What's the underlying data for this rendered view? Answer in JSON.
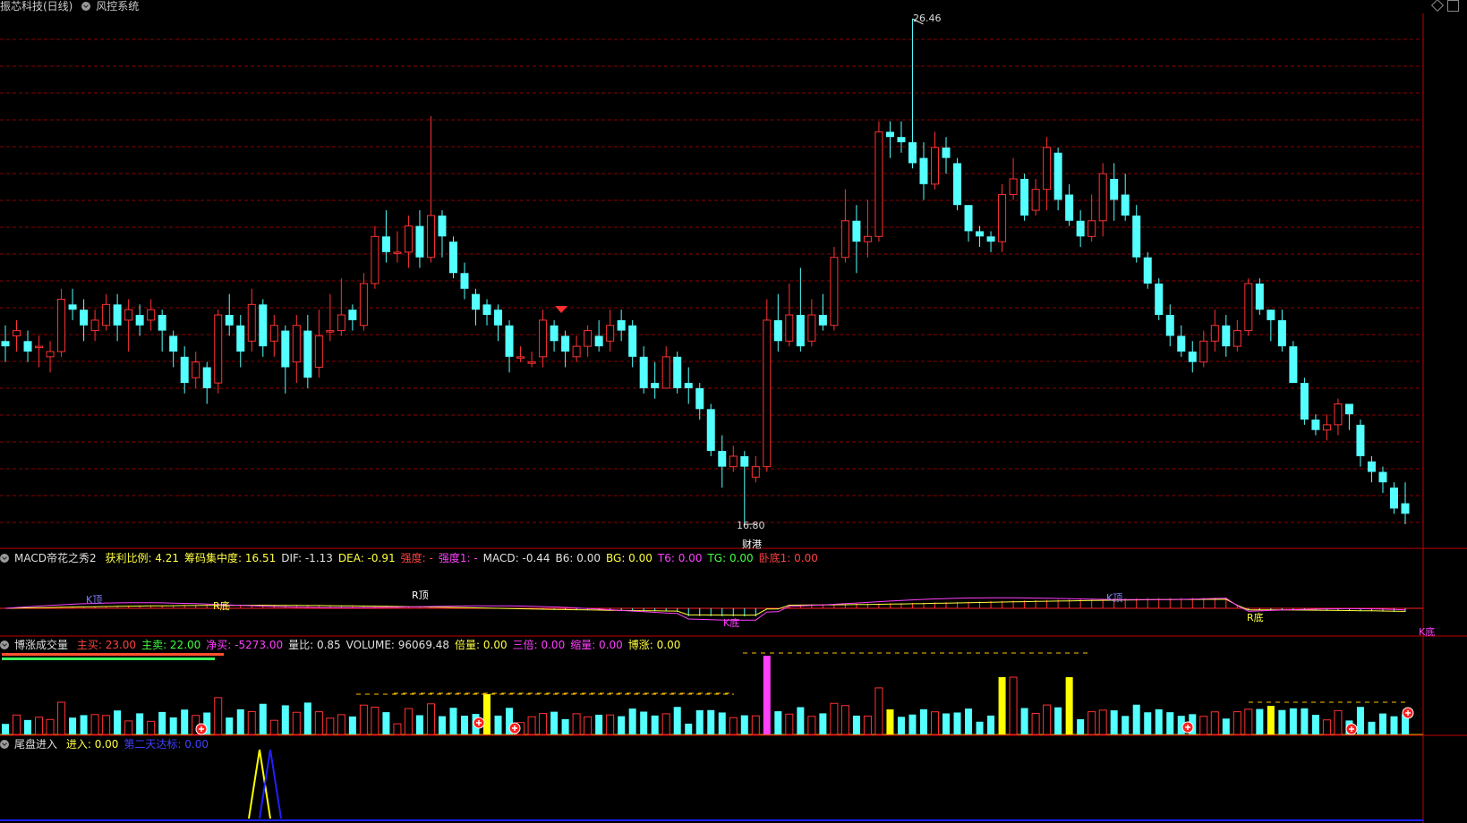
{
  "header": {
    "stock_name": "振芯科技(日线)",
    "system_name": "风控系统"
  },
  "price_panel": {
    "high_label": "26.46",
    "low_label": "16.80",
    "event_label": "财港"
  },
  "macd_panel": {
    "title": "MACD帝花之秀2",
    "items": [
      {
        "label": "获利比例: 4.21",
        "color": "#ffff40"
      },
      {
        "label": "筹码集中度: 16.51",
        "color": "#ffff40"
      },
      {
        "label": "DIF: -1.13",
        "color": "#e0e0e0"
      },
      {
        "label": "DEA: -0.91",
        "color": "#ffff40"
      },
      {
        "label": "强度: -",
        "color": "#ff4040"
      },
      {
        "label": "强度1: -",
        "color": "#ff40ff"
      },
      {
        "label": "MACD: -0.44",
        "color": "#e0e0e0"
      },
      {
        "label": "B6: 0.00",
        "color": "#e0e0e0"
      },
      {
        "label": "BG: 0.00",
        "color": "#ffff40"
      },
      {
        "label": "T6: 0.00",
        "color": "#ff40ff"
      },
      {
        "label": "TG: 0.00",
        "color": "#40ff40"
      },
      {
        "label": "卧底1: 0.00",
        "color": "#ff4040"
      }
    ],
    "markers": [
      {
        "text": "K顶",
        "color": "#8080ff"
      },
      {
        "text": "R底",
        "color": "#ffff40"
      },
      {
        "text": "R顶",
        "color": "#ffffff"
      },
      {
        "text": "K底",
        "color": "#ff40ff"
      },
      {
        "text": "K顶",
        "color": "#8080ff"
      },
      {
        "text": "R底",
        "color": "#ffff40"
      },
      {
        "text": "K底",
        "color": "#ff40ff"
      }
    ]
  },
  "volume_panel": {
    "title": "博涨成交量",
    "items": [
      {
        "label": "主买: 23.00",
        "color": "#ff4040"
      },
      {
        "label": "主卖: 22.00",
        "color": "#40ff40"
      },
      {
        "label": "净买: -5273.00",
        "color": "#ff40ff"
      },
      {
        "label": "量比: 0.85",
        "color": "#e0e0e0"
      },
      {
        "label": "VOLUME: 96069.48",
        "color": "#e0e0e0"
      },
      {
        "label": "倍量: 0.00",
        "color": "#ffff40"
      },
      {
        "label": "三倍: 0.00",
        "color": "#ff40ff"
      },
      {
        "label": "缩量: 0.00",
        "color": "#ff40ff"
      },
      {
        "label": "博涨: 0.00",
        "color": "#ffff40"
      }
    ]
  },
  "tail_panel": {
    "title": "尾盘进入",
    "items": [
      {
        "label": "进入: 0.00",
        "color": "#ffff40"
      },
      {
        "label": "第二天达标: 0.00",
        "color": "#4040ff"
      }
    ]
  },
  "colors": {
    "up": "#ff3232",
    "down": "#54ffff",
    "grid": "#8b0000",
    "axis": "#c00000"
  },
  "chart_data": {
    "type": "candlestick",
    "high": 26.46,
    "low": 16.8,
    "candles": [
      [
        20.3,
        20.2,
        20.6,
        19.9
      ],
      [
        20.4,
        20.5,
        20.7,
        20.1
      ],
      [
        20.3,
        20.1,
        20.5,
        19.9
      ],
      [
        20.2,
        20.2,
        20.4,
        19.8
      ],
      [
        20.0,
        20.1,
        20.3,
        19.7
      ],
      [
        20.1,
        21.1,
        21.3,
        20.0
      ],
      [
        21.0,
        20.9,
        21.3,
        20.7
      ],
      [
        20.9,
        20.6,
        21.1,
        20.3
      ],
      [
        20.5,
        20.7,
        20.9,
        20.3
      ],
      [
        20.6,
        21.0,
        21.2,
        20.5
      ],
      [
        21.0,
        20.6,
        21.2,
        20.3
      ],
      [
        20.7,
        20.9,
        21.1,
        20.1
      ],
      [
        20.8,
        20.6,
        21.0,
        20.4
      ],
      [
        20.7,
        20.9,
        21.1,
        20.5
      ],
      [
        20.8,
        20.5,
        20.9,
        20.1
      ],
      [
        20.4,
        20.1,
        20.5,
        19.8
      ],
      [
        20.0,
        19.5,
        20.2,
        19.3
      ],
      [
        19.6,
        19.9,
        20.1,
        19.4
      ],
      [
        19.8,
        19.4,
        19.9,
        19.1
      ],
      [
        19.5,
        20.8,
        20.9,
        19.3
      ],
      [
        20.8,
        20.6,
        21.2,
        20.4
      ],
      [
        20.6,
        20.1,
        20.8,
        19.8
      ],
      [
        20.3,
        21.0,
        21.3,
        20.1
      ],
      [
        21.0,
        20.2,
        21.1,
        20.0
      ],
      [
        20.3,
        20.6,
        20.8,
        20.0
      ],
      [
        20.5,
        19.8,
        20.6,
        19.3
      ],
      [
        19.9,
        20.6,
        20.8,
        19.5
      ],
      [
        20.5,
        19.6,
        20.8,
        19.4
      ],
      [
        19.8,
        20.4,
        20.9,
        19.6
      ],
      [
        20.5,
        20.5,
        21.2,
        20.3
      ],
      [
        20.5,
        20.8,
        21.5,
        20.4
      ],
      [
        20.9,
        20.7,
        21.0,
        20.5
      ],
      [
        20.6,
        21.4,
        21.6,
        20.5
      ],
      [
        21.4,
        22.3,
        22.5,
        21.3
      ],
      [
        22.3,
        22.0,
        22.8,
        21.8
      ],
      [
        22.0,
        22.0,
        22.4,
        21.8
      ],
      [
        22.0,
        22.5,
        22.7,
        21.7
      ],
      [
        22.5,
        21.9,
        22.8,
        21.7
      ],
      [
        21.9,
        22.7,
        24.6,
        21.8
      ],
      [
        22.7,
        22.3,
        22.8,
        21.9
      ],
      [
        22.2,
        21.6,
        22.3,
        21.5
      ],
      [
        21.6,
        21.3,
        21.8,
        21.1
      ],
      [
        21.2,
        20.9,
        21.3,
        20.6
      ],
      [
        21.0,
        20.8,
        21.1,
        20.6
      ],
      [
        20.9,
        20.6,
        21.0,
        20.3
      ],
      [
        20.6,
        20.0,
        20.7,
        19.7
      ],
      [
        20.0,
        20.0,
        20.2,
        19.9
      ],
      [
        19.9,
        19.9,
        20.1,
        19.8
      ],
      [
        20.0,
        20.7,
        20.9,
        19.8
      ],
      [
        20.6,
        20.3,
        20.7,
        20.1
      ],
      [
        20.4,
        20.1,
        20.5,
        19.8
      ],
      [
        20.0,
        20.2,
        20.4,
        19.9
      ],
      [
        20.2,
        20.5,
        20.6,
        20.0
      ],
      [
        20.4,
        20.2,
        20.7,
        20.1
      ],
      [
        20.3,
        20.6,
        20.9,
        20.1
      ],
      [
        20.7,
        20.5,
        20.9,
        20.3
      ],
      [
        20.6,
        20.0,
        20.7,
        19.8
      ],
      [
        20.0,
        19.4,
        20.2,
        19.3
      ],
      [
        19.5,
        19.4,
        19.9,
        19.2
      ],
      [
        19.4,
        20.0,
        20.2,
        19.4
      ],
      [
        20.0,
        19.4,
        20.1,
        19.3
      ],
      [
        19.5,
        19.4,
        19.8,
        19.1
      ],
      [
        19.4,
        19.0,
        19.5,
        18.8
      ],
      [
        19.0,
        18.2,
        19.1,
        18.1
      ],
      [
        18.2,
        17.9,
        18.5,
        17.5
      ],
      [
        17.9,
        18.1,
        18.3,
        17.8
      ],
      [
        18.1,
        17.9,
        18.2,
        16.8
      ],
      [
        17.7,
        17.9,
        18.1,
        17.6
      ],
      [
        17.9,
        20.7,
        21.1,
        17.8
      ],
      [
        20.7,
        20.3,
        21.2,
        20.1
      ],
      [
        20.3,
        20.8,
        21.4,
        20.2
      ],
      [
        20.8,
        20.2,
        21.7,
        20.1
      ],
      [
        20.3,
        20.8,
        21.1,
        20.2
      ],
      [
        20.8,
        20.6,
        21.2,
        20.5
      ],
      [
        20.6,
        21.9,
        22.1,
        20.5
      ],
      [
        21.9,
        22.6,
        23.2,
        21.8
      ],
      [
        22.6,
        22.2,
        22.9,
        21.6
      ],
      [
        22.2,
        22.3,
        23.0,
        21.9
      ],
      [
        22.3,
        24.3,
        24.5,
        22.2
      ],
      [
        24.3,
        24.2,
        24.5,
        23.8
      ],
      [
        24.2,
        24.1,
        24.5,
        23.9
      ],
      [
        24.1,
        23.7,
        26.46,
        23.6
      ],
      [
        23.8,
        23.3,
        24.1,
        23.0
      ],
      [
        23.3,
        24.0,
        24.3,
        23.2
      ],
      [
        24.0,
        23.8,
        24.2,
        23.5
      ],
      [
        23.7,
        22.9,
        23.8,
        22.8
      ],
      [
        22.9,
        22.4,
        22.9,
        22.2
      ],
      [
        22.4,
        22.3,
        22.5,
        22.1
      ],
      [
        22.3,
        22.2,
        22.4,
        22.0
      ],
      [
        22.2,
        23.1,
        23.3,
        22.0
      ],
      [
        23.1,
        23.4,
        23.8,
        23.0
      ],
      [
        23.4,
        22.7,
        23.5,
        22.6
      ],
      [
        22.8,
        23.2,
        23.4,
        22.7
      ],
      [
        23.2,
        24.0,
        24.2,
        22.8
      ],
      [
        23.9,
        23.0,
        24.0,
        22.8
      ],
      [
        23.1,
        22.6,
        23.3,
        22.5
      ],
      [
        22.6,
        22.3,
        22.8,
        22.1
      ],
      [
        22.3,
        22.6,
        23.1,
        22.2
      ],
      [
        22.6,
        23.5,
        23.7,
        22.3
      ],
      [
        23.4,
        23.0,
        23.7,
        22.6
      ],
      [
        23.1,
        22.7,
        23.5,
        22.6
      ],
      [
        22.7,
        21.9,
        22.9,
        21.8
      ],
      [
        21.9,
        21.4,
        22.0,
        21.3
      ],
      [
        21.4,
        20.8,
        21.5,
        20.7
      ],
      [
        20.8,
        20.4,
        21.0,
        20.2
      ],
      [
        20.4,
        20.1,
        20.6,
        20.0
      ],
      [
        20.1,
        19.9,
        20.3,
        19.7
      ],
      [
        19.9,
        20.3,
        20.5,
        19.8
      ],
      [
        20.3,
        20.6,
        20.9,
        20.1
      ],
      [
        20.6,
        20.2,
        20.8,
        20.0
      ],
      [
        20.2,
        20.5,
        20.7,
        20.1
      ],
      [
        20.5,
        21.4,
        21.5,
        20.4
      ],
      [
        21.4,
        20.9,
        21.5,
        20.8
      ],
      [
        20.9,
        20.7,
        20.9,
        20.3
      ],
      [
        20.7,
        20.2,
        20.9,
        20.1
      ],
      [
        20.2,
        19.5,
        20.3,
        19.5
      ],
      [
        19.5,
        18.8,
        19.6,
        18.7
      ],
      [
        18.8,
        18.6,
        18.9,
        18.5
      ],
      [
        18.6,
        18.7,
        18.9,
        18.4
      ],
      [
        18.7,
        19.1,
        19.2,
        18.5
      ],
      [
        19.1,
        18.9,
        19.0,
        18.6
      ],
      [
        18.7,
        18.1,
        18.8,
        17.9
      ],
      [
        18.0,
        17.8,
        18.1,
        17.6
      ],
      [
        17.8,
        17.6,
        17.9,
        17.4
      ],
      [
        17.5,
        17.1,
        17.6,
        17.0
      ],
      [
        17.2,
        17.0,
        17.6,
        16.8
      ]
    ]
  }
}
